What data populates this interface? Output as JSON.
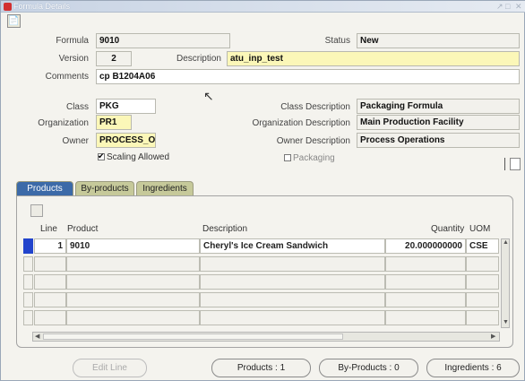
{
  "window": {
    "title": "Formula Details",
    "controls": [
      "↗",
      "□",
      "✕"
    ]
  },
  "header": {
    "formula_label": "Formula",
    "formula_value": "9010",
    "status_label": "Status",
    "status_value": "New",
    "version_label": "Version",
    "version_value": "2",
    "description_label": "Description",
    "description_value": "atu_inp_test",
    "comments_label": "Comments",
    "comments_value": "cp B1204A06",
    "class_label": "Class",
    "class_value": "PKG",
    "class_desc_label": "Class Description",
    "class_desc_value": "Packaging Formula",
    "org_label": "Organization",
    "org_value": "PR1",
    "org_desc_label": "Organization Description",
    "org_desc_value": "Main Production Facility",
    "owner_label": "Owner",
    "owner_value": "PROCESS_O",
    "owner_desc_label": "Owner Description",
    "owner_desc_value": "Process Operations",
    "scaling_label": "Scaling Allowed",
    "scaling_checked": true,
    "packaging_label": "Packaging",
    "packaging_checked": false
  },
  "tabs": [
    {
      "label": "Products",
      "active": true
    },
    {
      "label": "By-products",
      "active": false
    },
    {
      "label": "Ingredients",
      "active": false
    }
  ],
  "grid": {
    "columns": [
      "Line",
      "Product",
      "Description",
      "Quantity",
      "UOM"
    ],
    "rows": [
      {
        "line": "1",
        "product": "9010",
        "description": "Cheryl's Ice Cream Sandwich",
        "quantity": "20.000000000",
        "uom": "CSE"
      }
    ]
  },
  "buttons": {
    "edit_line": "Edit Line",
    "products": "Products : 1",
    "by_products": "By-Products : 0",
    "ingredients": "Ingredients : 6"
  },
  "colors": {
    "active_tab": "#3c6aa8",
    "inactive_tab": "#c6c99a",
    "required_field": "#fbf7b8",
    "current_record": "#2244cc"
  }
}
